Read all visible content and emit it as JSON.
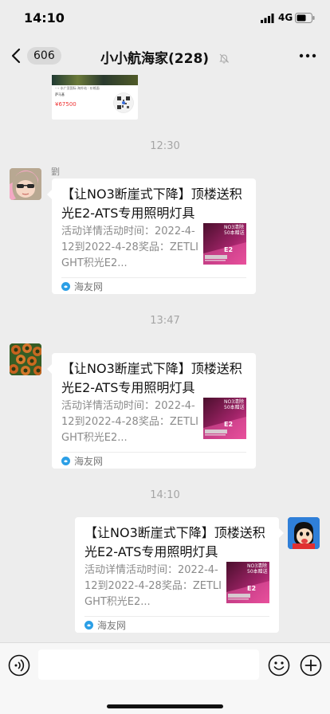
{
  "status_bar": {
    "time": "14:10",
    "network": "4G",
    "icons": [
      "signal-icon",
      "battery-icon"
    ]
  },
  "nav": {
    "back_icon": "chevron-left-icon",
    "unread_count": "606",
    "title": "小小航海家(228)",
    "mute_icon": "bell-slash-icon",
    "more_icon": "ellipsis-icon"
  },
  "partial_message": {
    "header_text": "···› 水广亚国际 海外站 · 价格面",
    "subtitle": "萨马基",
    "price": "¥67500"
  },
  "timestamps": [
    "12:30",
    "13:47",
    "14:10"
  ],
  "messages": [
    {
      "sender_name": "劉",
      "side": "left",
      "title": "【让NO3断崖式下降】顶楼送积光E2-ATS专用照明灯具",
      "description": "活动详情活动时间：2022-4-12到2022-4-28奖品：ZETLIGHT积光E2...",
      "thumbnail_text": [
        "NO3清除",
        "50本赠送"
      ],
      "thumbnail_model": "E2",
      "source": "海友网"
    },
    {
      "sender_name": "",
      "side": "left",
      "title": "【让NO3断崖式下降】顶楼送积光E2-ATS专用照明灯具",
      "description": "活动详情活动时间：2022-4-12到2022-4-28奖品：ZETLIGHT积光E2...",
      "thumbnail_text": [
        "NO3清除",
        "50本赠送"
      ],
      "thumbnail_model": "E2",
      "source": "海友网"
    },
    {
      "sender_name": "",
      "side": "right",
      "title": "【让NO3断崖式下降】顶楼送积光E2-ATS专用照明灯具",
      "description": "活动详情活动时间：2022-4-12到2022-4-28奖品：ZETLIGHT积光E2...",
      "thumbnail_text": [
        "NO3清除",
        "50本赠送"
      ],
      "thumbnail_model": "E2",
      "source": "海友网"
    }
  ],
  "input_bar": {
    "icons": [
      "voice-icon",
      "emoji-icon",
      "plus-icon"
    ],
    "placeholder": ""
  },
  "colors": {
    "background": "#ededed",
    "bubble": "#ffffff",
    "source_logo": "#2b9fe6",
    "price": "#e33333"
  }
}
